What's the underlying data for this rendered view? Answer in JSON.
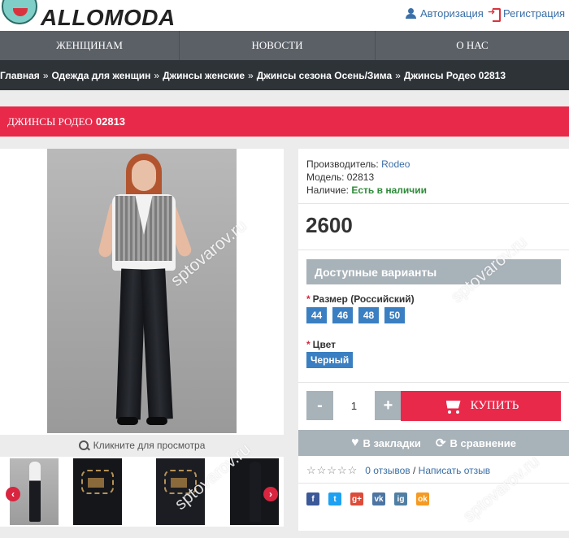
{
  "header": {
    "logo_text": "ALLOMODA",
    "login_label": "Авторизация",
    "register_label": "Регистрация"
  },
  "nav": {
    "items": [
      {
        "label": "Женщинам"
      },
      {
        "label": "Новости"
      },
      {
        "label": "О нас"
      }
    ]
  },
  "breadcrumbs": {
    "items": [
      "Главная",
      "Одежда для женщин",
      "Джинсы женские",
      "Джинсы сезона Осень/Зима",
      "Джинсы Родео 02813"
    ],
    "separator": "»"
  },
  "product": {
    "title_prefix": "Джинсы Родео",
    "title_code": "02813",
    "zoom_caption": "Кликните для просмотра",
    "manufacturer_label": "Производитель:",
    "manufacturer": "Rodeo",
    "model_label": "Модель:",
    "model": "02813",
    "availability_label": "Наличие:",
    "availability": "Есть в наличии",
    "price": "2600",
    "variants_heading": "Доступные варианты",
    "size_label": "Размер (Российский)",
    "sizes": [
      "44",
      "46",
      "48",
      "50"
    ],
    "color_label": "Цвет",
    "color_value": "Черный",
    "quantity": "1",
    "minus_label": "-",
    "plus_label": "+",
    "buy_label": "Купить",
    "wishlist_label": "В закладки",
    "compare_label": "В сравнение",
    "stars": "☆☆☆☆☆",
    "reviews_label": "0 отзывов",
    "reviews_sep": "/",
    "write_review_label": "Написать отзыв"
  },
  "carousel": {
    "prev": "‹",
    "next": "›"
  },
  "social": [
    "f",
    "t",
    "g+",
    "vk",
    "ig",
    "ok"
  ],
  "watermark": "sptovarov.ru",
  "colors": {
    "accent_red": "#e8294a",
    "nav_gray": "#5b6067",
    "breadcrumb_dark": "#2e3338",
    "chip_blue": "#3a7fc1",
    "panel_gray": "#a8b2b9"
  }
}
